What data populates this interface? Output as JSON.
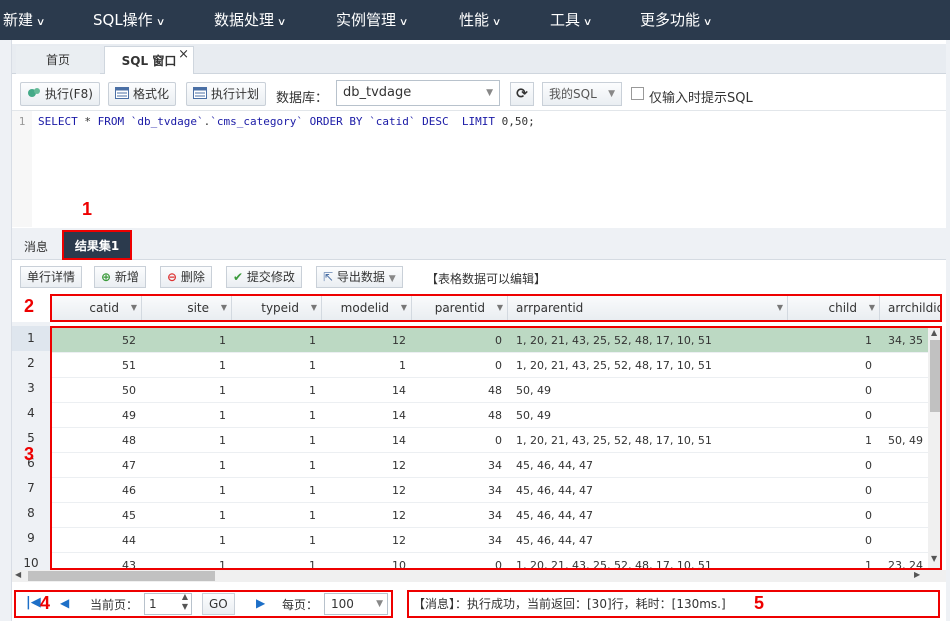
{
  "nav": {
    "items": [
      "新建",
      "SQL操作",
      "数据处理",
      "实例管理",
      "性能",
      "工具",
      "更多功能"
    ]
  },
  "tabs": {
    "home": "首页",
    "sql": "SQL 窗口",
    "close": "×"
  },
  "toolbar": {
    "execute": "执行(F8)",
    "format": "格式化",
    "plan": "执行计划",
    "db_label": "数据库：",
    "db_value": "db_tvdage",
    "mysql": "我的SQL",
    "hint": "仅输入时提示SQL"
  },
  "editor": {
    "line": "1",
    "sql": "SELECT * FROM `db_tvdage`.`cms_category` ORDER BY `catid` DESC  LIMIT 0,50;"
  },
  "result_tabs": {
    "messages": "消息",
    "resultset": "结果集1"
  },
  "result_toolbar": {
    "detail": "单行详情",
    "add": "新增",
    "delete": "删除",
    "commit": "提交修改",
    "export": "导出数据",
    "note": "【表格数据可以编辑】"
  },
  "grid": {
    "columns": [
      "catid",
      "site",
      "typeid",
      "modelid",
      "parentid",
      "arrparentid",
      "child",
      "arrchildid"
    ],
    "rows": [
      [
        "52",
        "1",
        "1",
        "12",
        "0",
        "1, 20, 21, 43, 25, 52, 48, 17, 10, 51",
        "1",
        "34, 35"
      ],
      [
        "51",
        "1",
        "1",
        "1",
        "0",
        "1, 20, 21, 43, 25, 52, 48, 17, 10, 51",
        "0",
        ""
      ],
      [
        "50",
        "1",
        "1",
        "14",
        "48",
        "50, 49",
        "0",
        ""
      ],
      [
        "49",
        "1",
        "1",
        "14",
        "48",
        "50, 49",
        "0",
        ""
      ],
      [
        "48",
        "1",
        "1",
        "14",
        "0",
        "1, 20, 21, 43, 25, 52, 48, 17, 10, 51",
        "1",
        "50, 49"
      ],
      [
        "47",
        "1",
        "1",
        "12",
        "34",
        "45, 46, 44, 47",
        "0",
        ""
      ],
      [
        "46",
        "1",
        "1",
        "12",
        "34",
        "45, 46, 44, 47",
        "0",
        ""
      ],
      [
        "45",
        "1",
        "1",
        "12",
        "34",
        "45, 46, 44, 47",
        "0",
        ""
      ],
      [
        "44",
        "1",
        "1",
        "12",
        "34",
        "45, 46, 44, 47",
        "0",
        ""
      ],
      [
        "43",
        "1",
        "1",
        "10",
        "0",
        "1, 20, 21, 43, 25, 52, 48, 17, 10, 51",
        "1",
        "23, 24"
      ]
    ],
    "rownums": [
      "1",
      "2",
      "3",
      "4",
      "5",
      "6",
      "7",
      "8",
      "9",
      "10"
    ]
  },
  "pager": {
    "current_label": "当前页：",
    "current": "1",
    "go": "GO",
    "per_label": "每页：",
    "per": "100"
  },
  "status": {
    "message": "【消息】：执行成功，当前返回：[30]行，耗时：[130ms.]"
  },
  "annotations": [
    "1",
    "2",
    "3",
    "4",
    "5"
  ],
  "colors": {
    "nav_bg": "#2b3a4d",
    "highlight": "#e00",
    "selected_row": "#bcd9c3"
  }
}
